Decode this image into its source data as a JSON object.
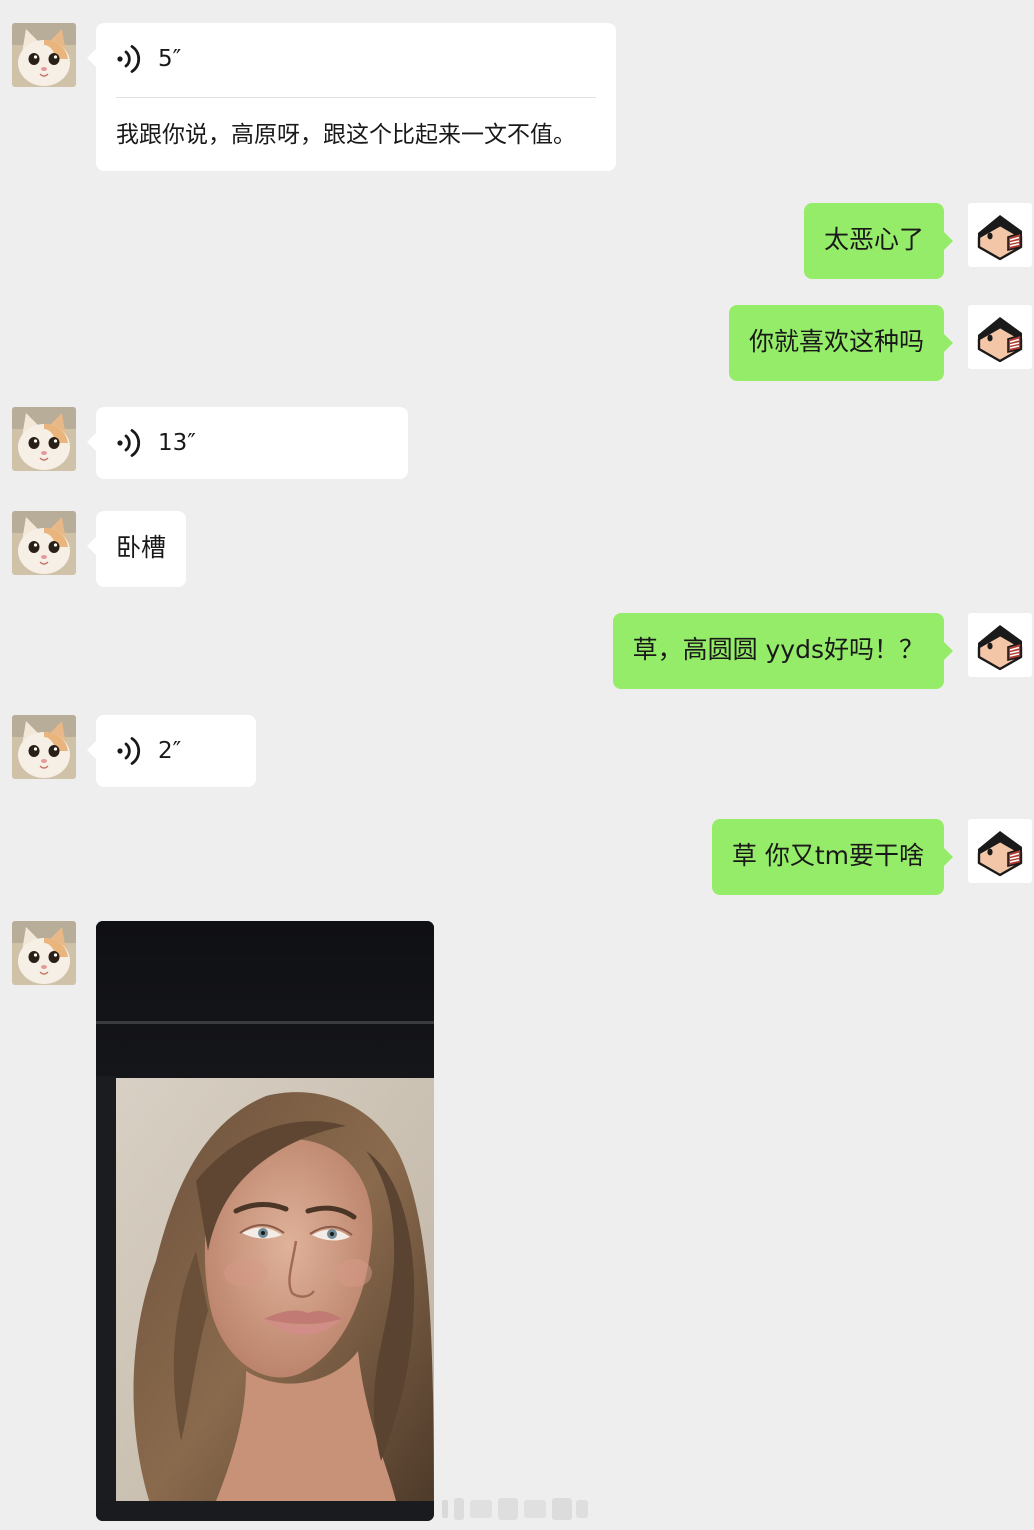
{
  "messages": [
    {
      "id": 1,
      "side": "left",
      "type": "voice",
      "duration": "5″",
      "transcript": "我跟你说，高原呀，跟这个比起来一文不值。"
    },
    {
      "id": 2,
      "side": "right",
      "type": "text",
      "text": "太恶心了"
    },
    {
      "id": 3,
      "side": "right",
      "type": "text",
      "text": "你就喜欢这种吗"
    },
    {
      "id": 4,
      "side": "left",
      "type": "voice",
      "duration": "13″"
    },
    {
      "id": 5,
      "side": "left",
      "type": "text",
      "text": "卧槽"
    },
    {
      "id": 6,
      "side": "right",
      "type": "text",
      "text": "草，高圆圆 yyds好吗！？"
    },
    {
      "id": 7,
      "side": "left",
      "type": "voice",
      "duration": "2″"
    },
    {
      "id": 8,
      "side": "right",
      "type": "text",
      "text": "草 你又tm要干啥"
    },
    {
      "id": 9,
      "side": "left",
      "type": "image",
      "image_description": "photo-portrait"
    }
  ],
  "avatars": {
    "left": "cat-avatar-icon",
    "right": "cartoon-face-avatar-icon"
  },
  "colors": {
    "background": "#eeeeee",
    "incoming_bubble": "#ffffff",
    "outgoing_bubble": "#95ec69",
    "text": "#191919"
  }
}
